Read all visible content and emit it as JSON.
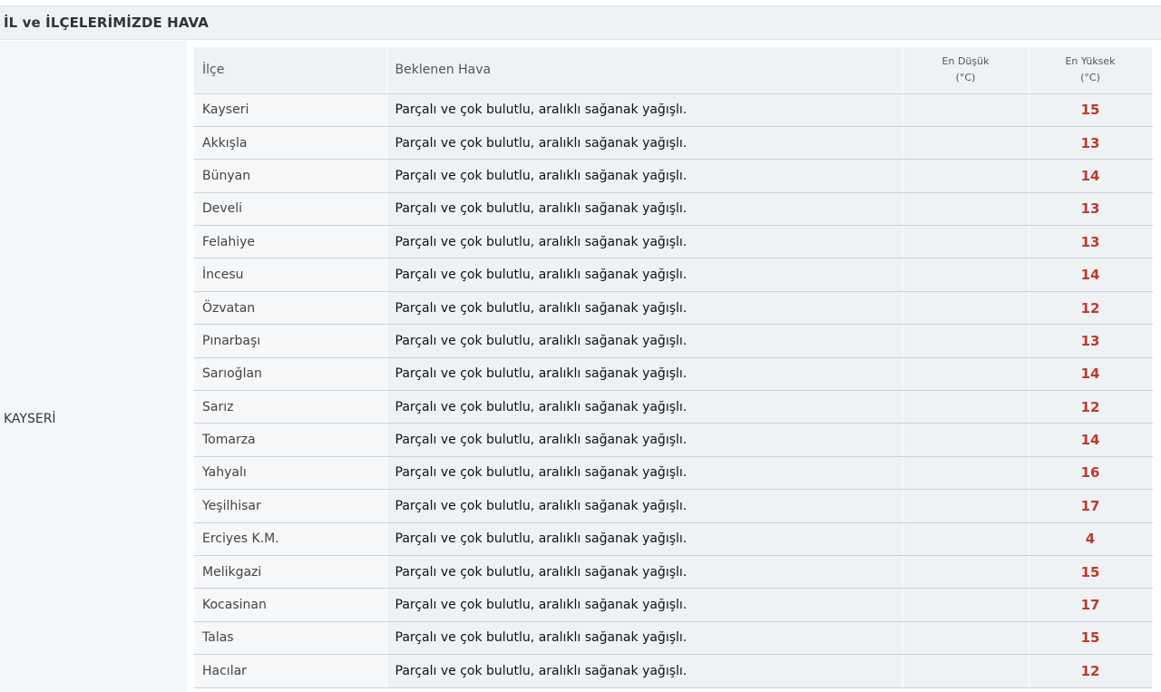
{
  "title": "İL ve İLÇELERİMİZDE HAVA",
  "province": "KAYSERİ",
  "table": {
    "headers": {
      "ilce": "İlçe",
      "hava": "Beklenen Hava",
      "min_line1": "En Düşük",
      "min_line2": "(°C)",
      "max_line1": "En Yüksek",
      "max_line2": "(°C)"
    },
    "rows": [
      {
        "ilce": "Kayseri",
        "hava": "Parçalı ve çok bulutlu, aralıklı sağanak yağışlı.",
        "min": "",
        "max": "15"
      },
      {
        "ilce": "Akkışla",
        "hava": "Parçalı ve çok bulutlu, aralıklı sağanak yağışlı.",
        "min": "",
        "max": "13"
      },
      {
        "ilce": "Bünyan",
        "hava": "Parçalı ve çok bulutlu, aralıklı sağanak yağışlı.",
        "min": "",
        "max": "14"
      },
      {
        "ilce": "Develi",
        "hava": "Parçalı ve çok bulutlu, aralıklı sağanak yağışlı.",
        "min": "",
        "max": "13"
      },
      {
        "ilce": "Felahiye",
        "hava": "Parçalı ve çok bulutlu, aralıklı sağanak yağışlı.",
        "min": "",
        "max": "13"
      },
      {
        "ilce": "İncesu",
        "hava": "Parçalı ve çok bulutlu, aralıklı sağanak yağışlı.",
        "min": "",
        "max": "14"
      },
      {
        "ilce": "Özvatan",
        "hava": "Parçalı ve çok bulutlu, aralıklı sağanak yağışlı.",
        "min": "",
        "max": "12"
      },
      {
        "ilce": "Pınarbaşı",
        "hava": "Parçalı ve çok bulutlu, aralıklı sağanak yağışlı.",
        "min": "",
        "max": "13"
      },
      {
        "ilce": "Sarıoğlan",
        "hava": "Parçalı ve çok bulutlu, aralıklı sağanak yağışlı.",
        "min": "",
        "max": "14"
      },
      {
        "ilce": "Sarız",
        "hava": "Parçalı ve çok bulutlu, aralıklı sağanak yağışlı.",
        "min": "",
        "max": "12"
      },
      {
        "ilce": "Tomarza",
        "hava": "Parçalı ve çok bulutlu, aralıklı sağanak yağışlı.",
        "min": "",
        "max": "14"
      },
      {
        "ilce": "Yahyalı",
        "hava": "Parçalı ve çok bulutlu, aralıklı sağanak yağışlı.",
        "min": "",
        "max": "16"
      },
      {
        "ilce": "Yeşilhisar",
        "hava": "Parçalı ve çok bulutlu, aralıklı sağanak yağışlı.",
        "min": "",
        "max": "17"
      },
      {
        "ilce": "Erciyes K.M.",
        "hava": "Parçalı ve çok bulutlu, aralıklı sağanak yağışlı.",
        "min": "",
        "max": "4"
      },
      {
        "ilce": "Melikgazi",
        "hava": "Parçalı ve çok bulutlu, aralıklı sağanak yağışlı.",
        "min": "",
        "max": "15"
      },
      {
        "ilce": "Kocasinan",
        "hava": "Parçalı ve çok bulutlu, aralıklı sağanak yağışlı.",
        "min": "",
        "max": "17"
      },
      {
        "ilce": "Talas",
        "hava": "Parçalı ve çok bulutlu, aralıklı sağanak yağışlı.",
        "min": "",
        "max": "15"
      },
      {
        "ilce": "Hacılar",
        "hava": "Parçalı ve çok bulutlu, aralıklı sağanak yağışlı.",
        "min": "",
        "max": "12"
      }
    ]
  },
  "colors": {
    "max_temp": "#c0392b",
    "header_bg": "#eef2f5"
  }
}
